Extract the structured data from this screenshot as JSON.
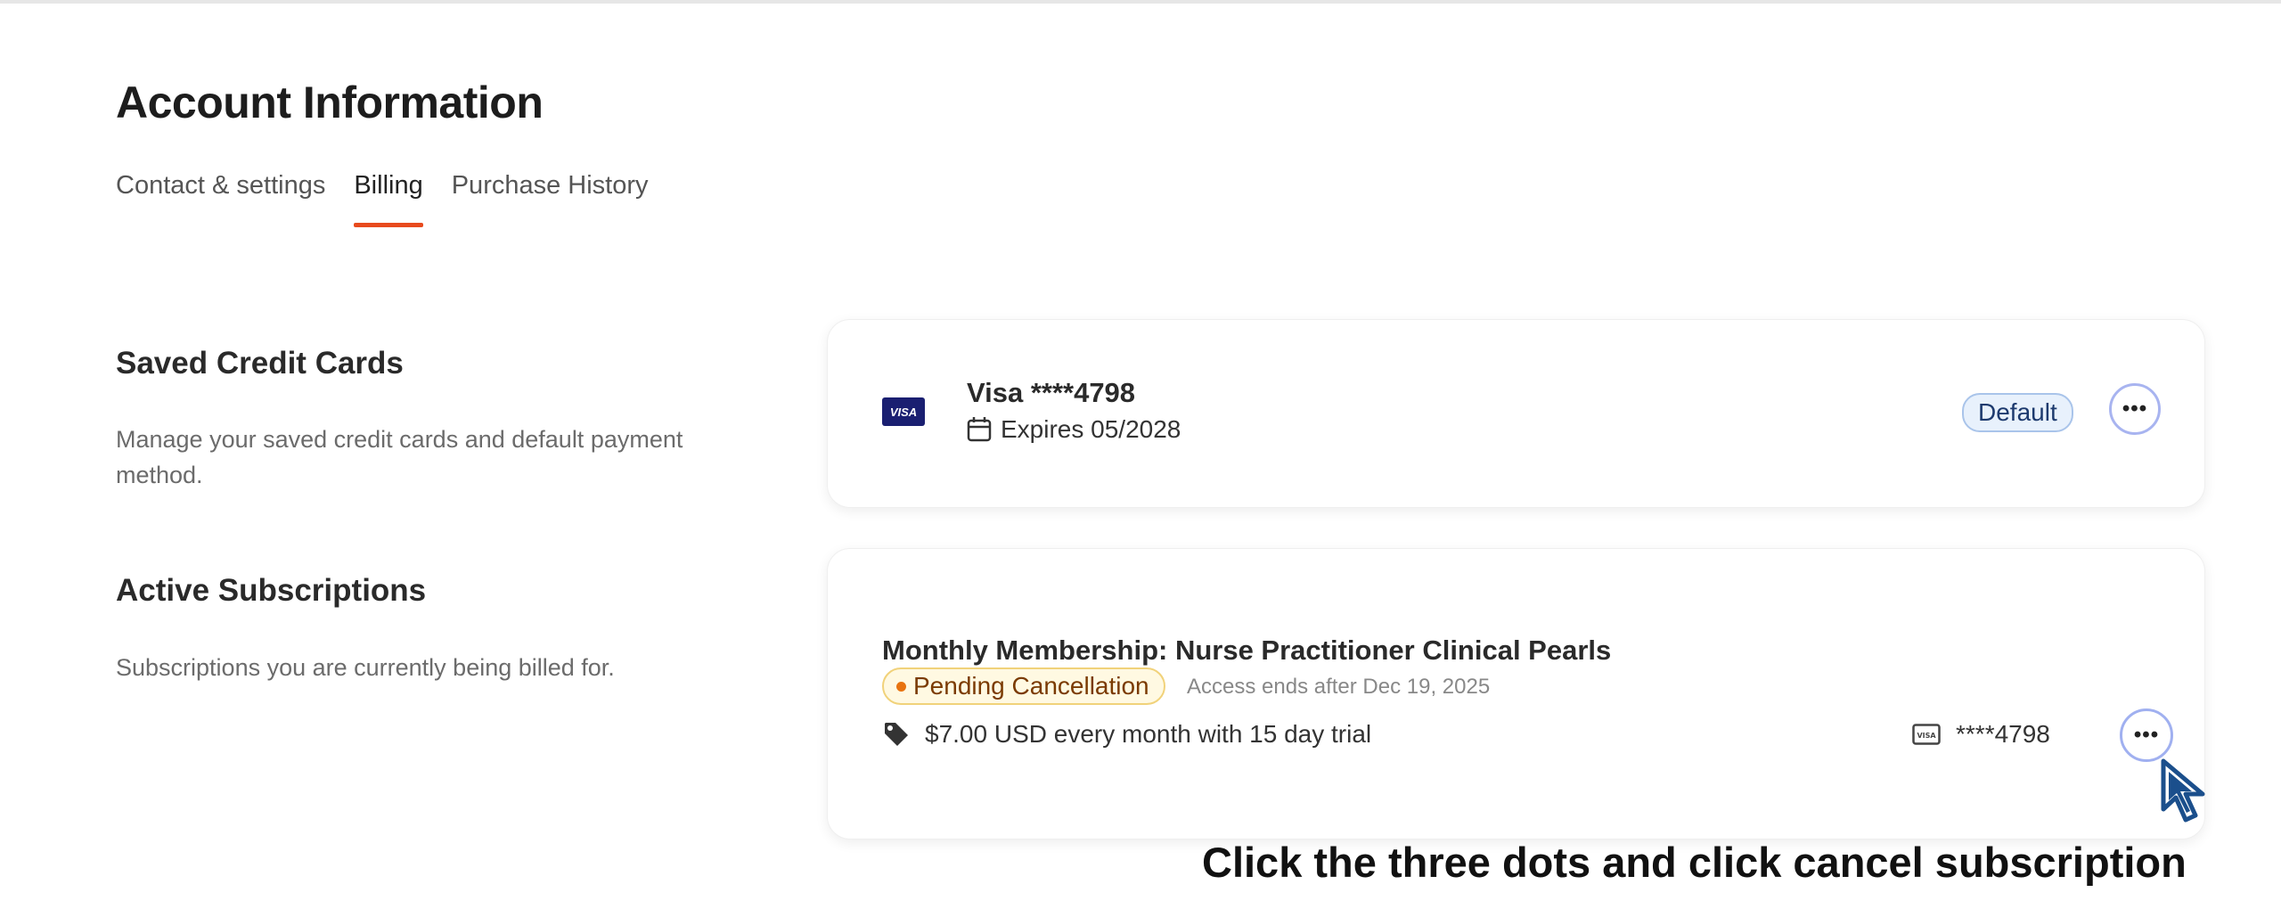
{
  "page": {
    "title": "Account Information"
  },
  "tabs": [
    {
      "label": "Contact & settings",
      "active": false
    },
    {
      "label": "Billing",
      "active": true
    },
    {
      "label": "Purchase History",
      "active": false
    }
  ],
  "saved_cards": {
    "title": "Saved Credit Cards",
    "description": "Manage your saved credit cards and default payment method.",
    "card": {
      "brand_logo": "VISA",
      "name": "Visa ****4798",
      "expires": "Expires 05/2028",
      "badge": "Default",
      "menu_icon": "ellipsis-icon"
    }
  },
  "subscriptions": {
    "title": "Active Subscriptions",
    "description": "Subscriptions you are currently being billed for.",
    "item": {
      "name": "Monthly Membership: Nurse Practitioner Clinical Pearls",
      "status": "Pending Cancellation",
      "access": "Access ends after Dec 19, 2025",
      "price": "$7.00 USD every month with 15 day trial",
      "card_number": "****4798",
      "card_icon_text": "VISA",
      "menu_icon": "ellipsis-icon"
    }
  },
  "instruction": "Click the three dots and click cancel subscription",
  "colors": {
    "accent": "#e84a1d",
    "default_badge_bg": "#e8f1fc",
    "pending_badge_bg": "#fff9e2",
    "pending_dot": "#e8730f",
    "visa_blue": "#1a1f71",
    "cursor_blue": "#1b4f8c"
  }
}
